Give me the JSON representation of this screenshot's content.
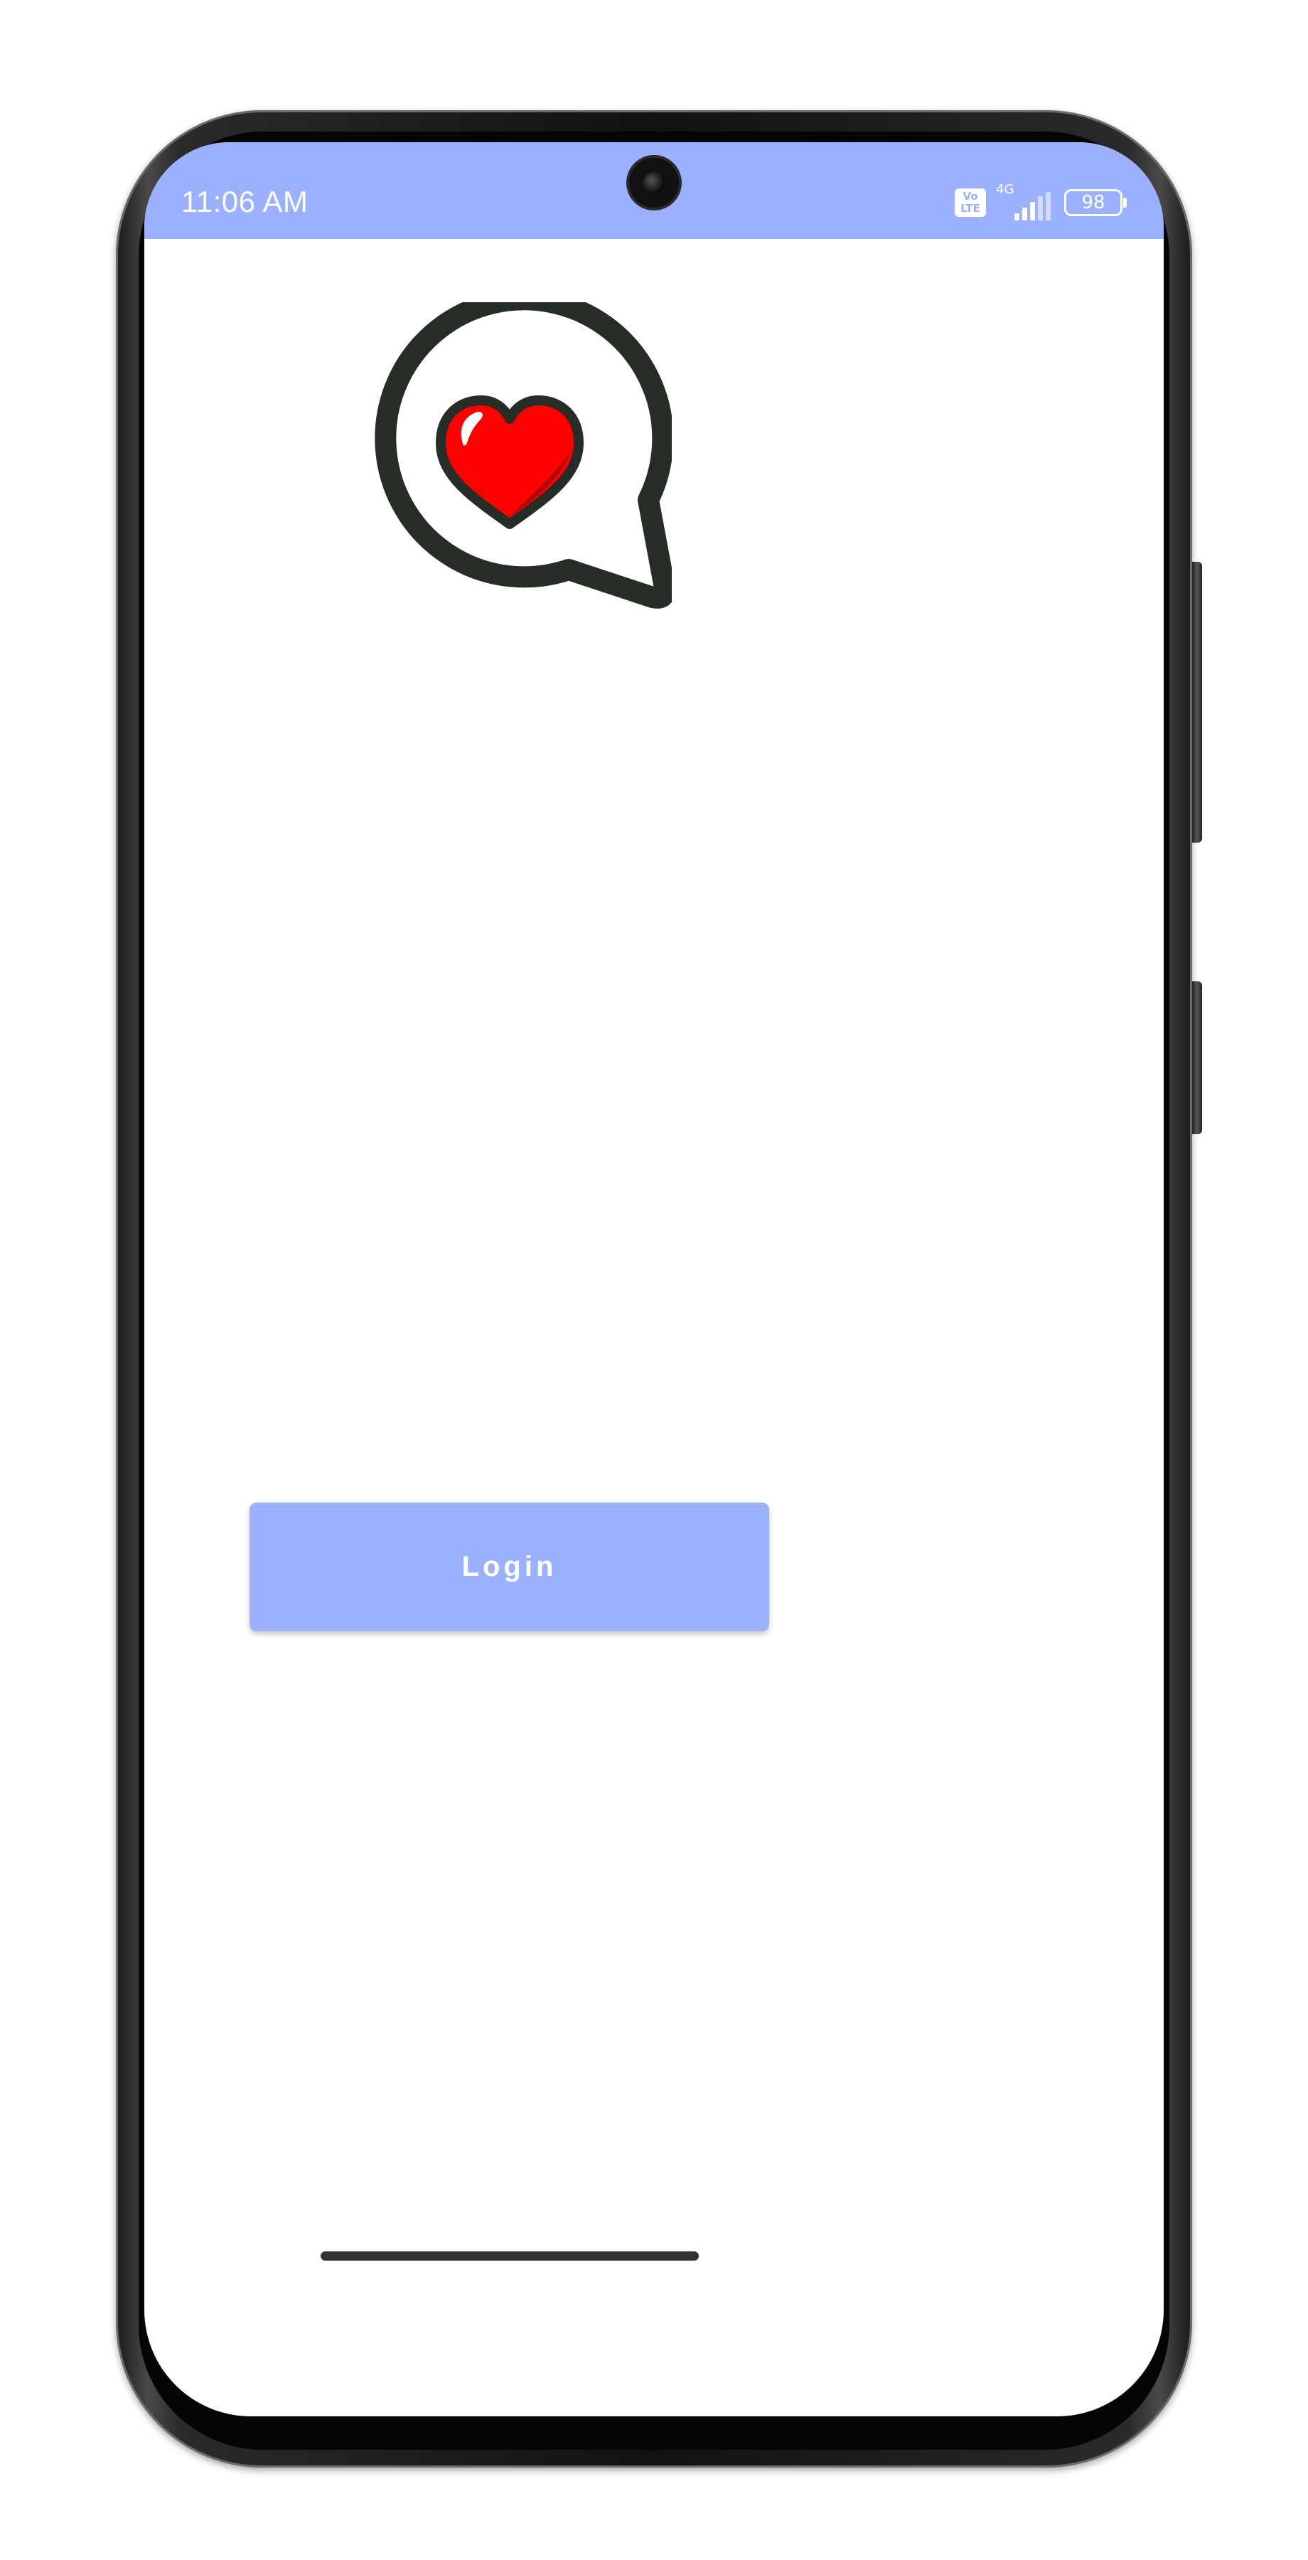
{
  "status_bar": {
    "time": "11:06 AM",
    "volte_top": "Vo",
    "volte_bottom": "LTE",
    "network": "4G",
    "battery": "98",
    "background_color": "#9bb1ff"
  },
  "app": {
    "logo_icon": "heart-speech-bubble-icon",
    "login_label": "Login",
    "accent_color": "#9bb1ff"
  },
  "navigation": {
    "home_indicator_icon": "home-indicator"
  }
}
